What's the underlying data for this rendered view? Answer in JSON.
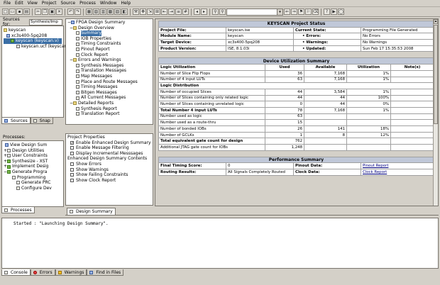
{
  "menu": [
    "File",
    "Edit",
    "View",
    "Project",
    "Source",
    "Process",
    "Window",
    "Help"
  ],
  "sources": {
    "label": "Sources for:",
    "select": "Synthesis/Imp",
    "tree": [
      "keyscan",
      "xc3s400-5pq208",
      "keyscan (keyscan.v)",
      "keyscan.ucf (keyscan.ucf)"
    ],
    "tabs": [
      "Sources",
      "Snap"
    ]
  },
  "processes": {
    "title": "Processes:",
    "items": [
      "View Design Sum",
      "Design Utilities",
      "User Constraints",
      "Synthesize - XST",
      "Implement Desig",
      "Generate Progra",
      "Programming",
      "Generate PRC",
      "Configure Dev"
    ],
    "tab": "Processes"
  },
  "summary_tree": {
    "items": [
      "FPGA Design Summary",
      "Design Overview",
      "Summary",
      "IOB Properties",
      "Timing Constraints",
      "Pinout Report",
      "Clock Report",
      "Errors and Warnings",
      "Synthesis Messages",
      "Translation Messages",
      "Map Messages",
      "Place and Route Messages",
      "Timing Messages",
      "Bitgen Messages",
      "All Current Messages",
      "Detailed Reports",
      "Synthesis Report",
      "Translation Report"
    ]
  },
  "project_properties": {
    "title": "Project Properties",
    "items": [
      "Enable Enhanced Design Summary",
      "Enable Message Filtering",
      "Display Incremental Messsages"
    ],
    "checked": [
      true,
      false,
      false
    ],
    "contents_title": "Enhanced Design Summary Contents",
    "contents": [
      "Show Errors",
      "Show Warnings",
      "Show Failing Constraints",
      "Show Clock Report"
    ]
  },
  "status": {
    "title": "KEYSCAN Project Status",
    "rows": [
      [
        "Project File:",
        "keyscan.ise",
        "Current State:",
        "Programming File Generated"
      ],
      [
        "Module Name:",
        "keyscan",
        "• Errors:",
        "No Errors"
      ],
      [
        "Target Device:",
        "xc3s400-5pq208",
        "• Warnings:",
        "No Warnings"
      ],
      [
        "Product Version:",
        "ISE, 8.1.03i",
        "• Updated:",
        "Sun Feb 17 15:35:53 2008"
      ]
    ]
  },
  "utilization": {
    "title": "Device Utilization Summary",
    "headers": [
      "Logic Utilization",
      "Used",
      "Available",
      "Utilization",
      "Note(s)"
    ],
    "rows": [
      [
        "Number of Slice Flip Flops",
        "36",
        "7,168",
        "1%",
        "",
        ""
      ],
      [
        "Number of 4 input LUTs",
        "63",
        "7,168",
        "1%",
        "",
        ""
      ],
      [
        "Logic Distribution",
        "",
        "",
        "",
        "",
        "bold"
      ],
      [
        "Number of occupied Slices",
        "44",
        "3,584",
        "1%",
        "",
        ""
      ],
      [
        "Number of Slices containing only related logic",
        "44",
        "44",
        "100%",
        "",
        ""
      ],
      [
        "Number of Slices containing unrelated logic",
        "0",
        "44",
        "0%",
        "",
        ""
      ],
      [
        "Total Number 4 input LUTs",
        "78",
        "7,168",
        "1%",
        "",
        "bold"
      ],
      [
        "Number used as logic",
        "63",
        "",
        "",
        "",
        ""
      ],
      [
        "Number used as a route-thru",
        "15",
        "",
        "",
        "",
        ""
      ],
      [
        "Number of bonded IOBs",
        "26",
        "141",
        "18%",
        "",
        ""
      ],
      [
        "Number of GCLKs",
        "1",
        "8",
        "12%",
        "",
        ""
      ],
      [
        "Total equivalent gate count for design",
        "762",
        "",
        "",
        "",
        "bold"
      ],
      [
        "Additional JTAG gate count for IOBs",
        "1,248",
        "",
        "",
        "",
        ""
      ]
    ]
  },
  "performance": {
    "title": "Performance Summary",
    "rows": [
      [
        "Final Timing Score:",
        "0",
        "Pinout Data:",
        "Pinout Report"
      ],
      [
        "Routing Results:",
        "All Signals Completely Routed",
        "Clock Data:",
        "Clock Report"
      ]
    ]
  },
  "doc_tab": "Design Summary",
  "console": {
    "text": "Started : \"Launching Design Summary\".",
    "tabs": [
      "Console",
      "Errors",
      "Warnings",
      "Find in Files"
    ]
  }
}
